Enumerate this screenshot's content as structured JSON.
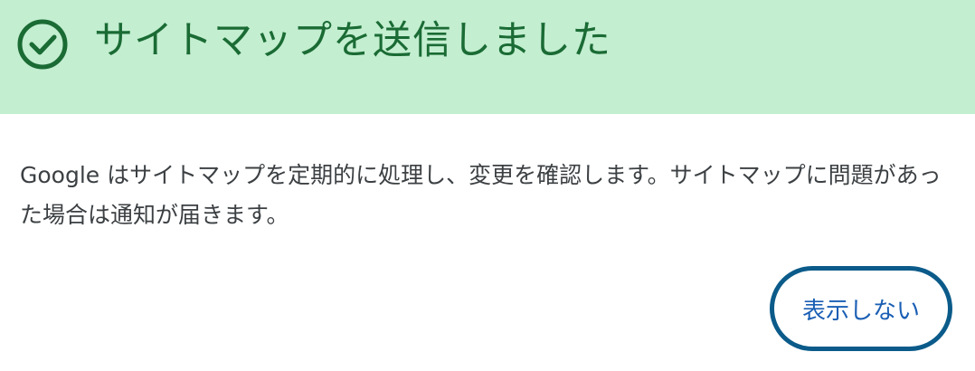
{
  "header": {
    "icon": "check-circle-icon",
    "title": "サイトマップを送信しました",
    "background_color": "#c3eed0",
    "accent_color": "#1a6b34"
  },
  "body": {
    "message": "Google はサイトマップを定期的に処理し、変更を確認します。サイトマップに問題があった場合は通知が届きます。"
  },
  "actions": {
    "dismiss_label": "表示しない",
    "button_border_color": "#0b5b8a",
    "button_text_color": "#1a5fb4"
  }
}
